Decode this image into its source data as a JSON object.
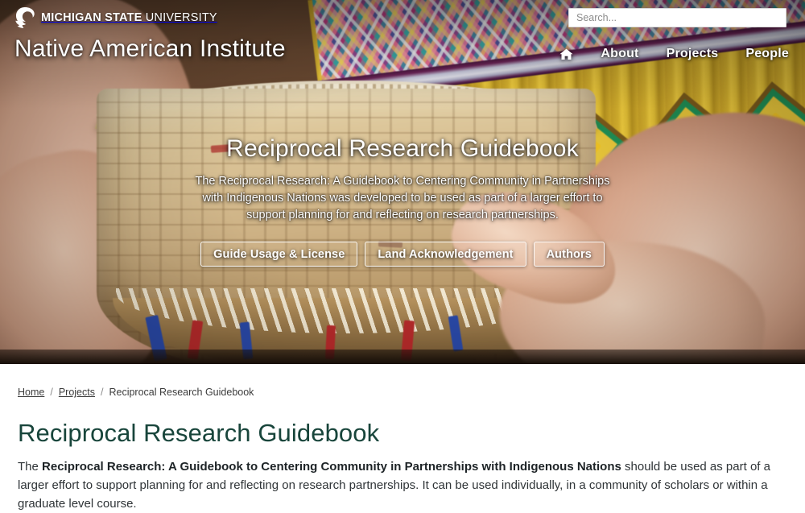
{
  "header": {
    "university_name_bold": "MICHIGAN STATE",
    "university_name_light": " UNIVERSITY",
    "logo_icon": "spartan-helmet-icon",
    "site_title": "Native American Institute"
  },
  "search": {
    "placeholder": "Search...",
    "value": ""
  },
  "nav": {
    "home_icon": "home-icon",
    "items": [
      {
        "label": "About"
      },
      {
        "label": "Projects"
      },
      {
        "label": "People"
      }
    ]
  },
  "hero": {
    "title": "Reciprocal Research Guidebook",
    "description": "The Reciprocal Research: A Guidebook to Centering Community in Partnerships with Indigenous Nations was developed to be used as part of a larger effort to support planning for and reflecting on research partnerships.",
    "buttons": [
      {
        "label": "Guide Usage & License"
      },
      {
        "label": "Land Acknowledgement"
      },
      {
        "label": "Authors"
      }
    ],
    "image_description": "Hands holding a woven black ash basket with colorful Native American textile in background"
  },
  "breadcrumb": {
    "separator": "/",
    "items": [
      {
        "label": "Home",
        "is_link": true
      },
      {
        "label": "Projects",
        "is_link": true
      },
      {
        "label": "Reciprocal Research Guidebook",
        "is_link": false
      }
    ]
  },
  "main": {
    "page_title": "Reciprocal Research Guidebook",
    "paragraph_lead": "The ",
    "paragraph_bold": "Reciprocal Research: A Guidebook to Centering Community in Partnerships with Indigenous Nations",
    "paragraph_rest": " should be used as part of a larger effort to support planning for and reflecting on research partnerships. It can be used individually, in a community of scholars or within a graduate level course."
  },
  "colors": {
    "msu_green": "#18453b",
    "hero_text": "#ffffff",
    "body_text": "#2f3437",
    "search_background": "#ffffff"
  }
}
